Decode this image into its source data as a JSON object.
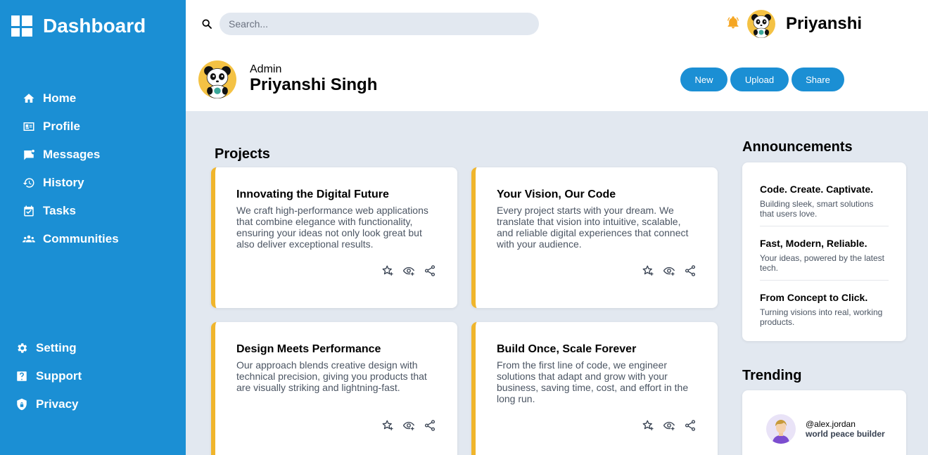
{
  "sidebar": {
    "title": "Dashboard",
    "items": [
      {
        "label": "Home",
        "icon": "home-icon"
      },
      {
        "label": "Profile",
        "icon": "id-card-icon"
      },
      {
        "label": "Messages",
        "icon": "message-icon"
      },
      {
        "label": "History",
        "icon": "history-icon"
      },
      {
        "label": "Tasks",
        "icon": "tasks-icon"
      },
      {
        "label": "Communities",
        "icon": "people-icon"
      }
    ],
    "bottom_items": [
      {
        "label": "Setting",
        "icon": "gear-icon"
      },
      {
        "label": "Support",
        "icon": "help-icon"
      },
      {
        "label": "Privacy",
        "icon": "shield-icon"
      }
    ]
  },
  "header": {
    "search_placeholder": "Search...",
    "username": "Priyanshi"
  },
  "profile": {
    "role": "Admin",
    "name": "Priyanshi Singh",
    "buttons": {
      "new": "New",
      "upload": "Upload",
      "share": "Share"
    }
  },
  "projects": {
    "title": "Projects",
    "cards": [
      {
        "title": "Innovating the Digital Future",
        "desc": "We craft high-performance web applications that combine elegance with functionality, ensuring your ideas not only look great but also deliver exceptional results."
      },
      {
        "title": "Your Vision, Our Code",
        "desc": "Every project starts with your dream. We translate that vision into intuitive, scalable, and reliable digital experiences that connect with your audience."
      },
      {
        "title": "Design Meets Performance",
        "desc": "Our approach blends creative design with technical precision, giving you products that are visually striking and lightning-fast."
      },
      {
        "title": "Build Once, Scale Forever",
        "desc": "From the first line of code, we engineer solutions that adapt and grow with your business, saving time, cost, and effort in the long run."
      }
    ]
  },
  "announcements": {
    "title": "Announcements",
    "items": [
      {
        "title": "Code. Create. Captivate.",
        "text": "Building sleek, smart solutions that users love."
      },
      {
        "title": "Fast, Modern, Reliable.",
        "text": "Your ideas, powered by the latest tech."
      },
      {
        "title": "From Concept to Click.",
        "text": "Turning visions into real, working products."
      }
    ]
  },
  "trending": {
    "title": "Trending",
    "items": [
      {
        "handle": "@alex.jordan",
        "desc": "world peace builder"
      }
    ]
  },
  "colors": {
    "sidebar": "#1b8fd4",
    "accent": "#f0b52c",
    "background": "#e2e8f0"
  }
}
